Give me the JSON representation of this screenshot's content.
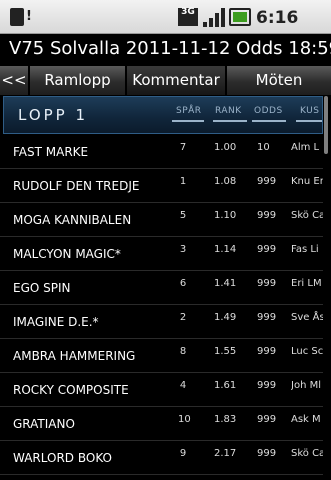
{
  "statusbar": {
    "network": "3G",
    "time": "6:16 PM"
  },
  "app": {
    "title": "V75 Solvalla 2011-11-12 Odds 18:59"
  },
  "tabs": [
    {
      "label": "<<"
    },
    {
      "label": "Ramlopp"
    },
    {
      "label": "Kommentar"
    },
    {
      "label": "Möten"
    }
  ],
  "race": {
    "title": "LOPP 1",
    "columns": {
      "spar": "SPÅR",
      "rank": "RANK",
      "odds": "ODDS",
      "kusk": "KUS"
    }
  },
  "horses": [
    {
      "name": "FAST MARKE",
      "spar": "7",
      "rank": "1.00",
      "odds": "10",
      "kusk": "Alm L"
    },
    {
      "name": "RUDOLF DEN TREDJE",
      "spar": "1",
      "rank": "1.08",
      "odds": "999",
      "kusk": "Knu Er"
    },
    {
      "name": "MOGA KANNIBALEN",
      "spar": "5",
      "rank": "1.10",
      "odds": "999",
      "kusk": "Skö Ca"
    },
    {
      "name": "MALCYON MAGIC*",
      "spar": "3",
      "rank": "1.14",
      "odds": "999",
      "kusk": "Fas Li"
    },
    {
      "name": "EGO SPIN",
      "spar": "6",
      "rank": "1.41",
      "odds": "999",
      "kusk": "Eri LM"
    },
    {
      "name": "IMAGINE D.E.*",
      "spar": "2",
      "rank": "1.49",
      "odds": "999",
      "kusk": "Sve Ås"
    },
    {
      "name": "AMBRA HAMMERING",
      "spar": "8",
      "rank": "1.55",
      "odds": "999",
      "kusk": "Luc Sc"
    },
    {
      "name": "ROCKY COMPOSITE",
      "spar": "4",
      "rank": "1.61",
      "odds": "999",
      "kusk": "Joh Ml"
    },
    {
      "name": "GRATIANO",
      "spar": "10",
      "rank": "1.83",
      "odds": "999",
      "kusk": "Ask M"
    },
    {
      "name": "WARLORD BOKO",
      "spar": "9",
      "rank": "2.17",
      "odds": "999",
      "kusk": "Skö Ca"
    }
  ],
  "colors": {
    "header_bg": "#10253a",
    "header_border": "#2f5d86",
    "battery": "#3c9c1e"
  }
}
